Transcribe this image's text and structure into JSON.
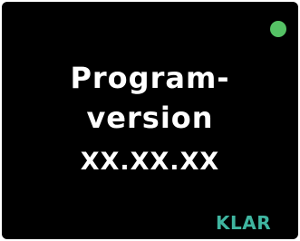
{
  "screen": {
    "title_line1": "Program-",
    "title_line2": "version",
    "version_value": "XX.XX.XX",
    "ready_label": "KLAR"
  },
  "colors": {
    "background": "#000000",
    "text": "#ffffff",
    "status_dot": "#55c265",
    "ready_label": "#3fb5a0"
  },
  "icons": {
    "status": "status-indicator-dot"
  }
}
